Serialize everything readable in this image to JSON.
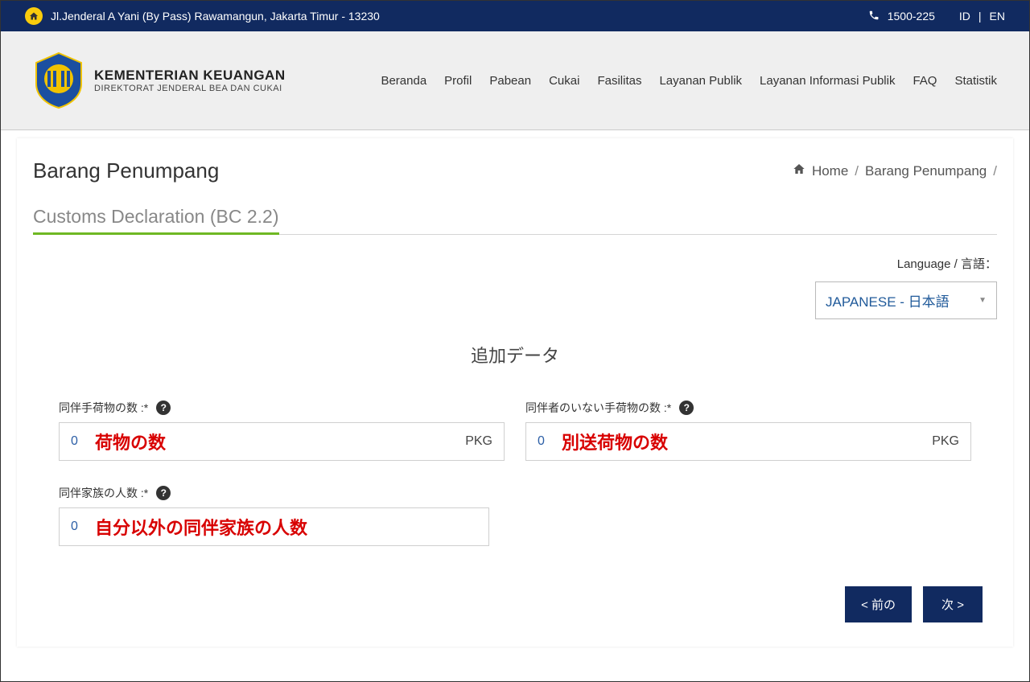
{
  "topbar": {
    "address": "Jl.Jenderal A Yani (By Pass) Rawamangun, Jakarta Timur - 13230",
    "phone": "1500-225",
    "lang_id": "ID",
    "lang_en": "EN"
  },
  "header": {
    "ministry": "KEMENTERIAN KEUANGAN",
    "dept": "DIREKTORAT JENDERAL BEA DAN CUKAI",
    "nav": [
      "Beranda",
      "Profil",
      "Pabean",
      "Cukai",
      "Fasilitas",
      "Layanan Publik",
      "Layanan Informasi Publik",
      "FAQ",
      "Statistik"
    ]
  },
  "breadcrumb": {
    "home": "Home",
    "current": "Barang Penumpang",
    "sep": "/"
  },
  "page": {
    "title": "Barang Penumpang",
    "section": "Customs Declaration (BC 2.2)",
    "language_label": "Language / 言語：",
    "language_value": "JAPANESE - 日本語",
    "form_heading": "追加データ",
    "fields": {
      "accompanied": {
        "label": "同伴手荷物の数 :*",
        "value": "0",
        "unit": "PKG",
        "overlay": "荷物の数"
      },
      "unaccompanied": {
        "label": "同伴者のいない手荷物の数 :*",
        "value": "0",
        "unit": "PKG",
        "overlay": "別送荷物の数"
      },
      "family": {
        "label": "同伴家族の人数 :*",
        "value": "0",
        "overlay": "自分以外の同伴家族の人数"
      }
    },
    "buttons": {
      "prev": "< 前の",
      "next": "次 >"
    }
  }
}
